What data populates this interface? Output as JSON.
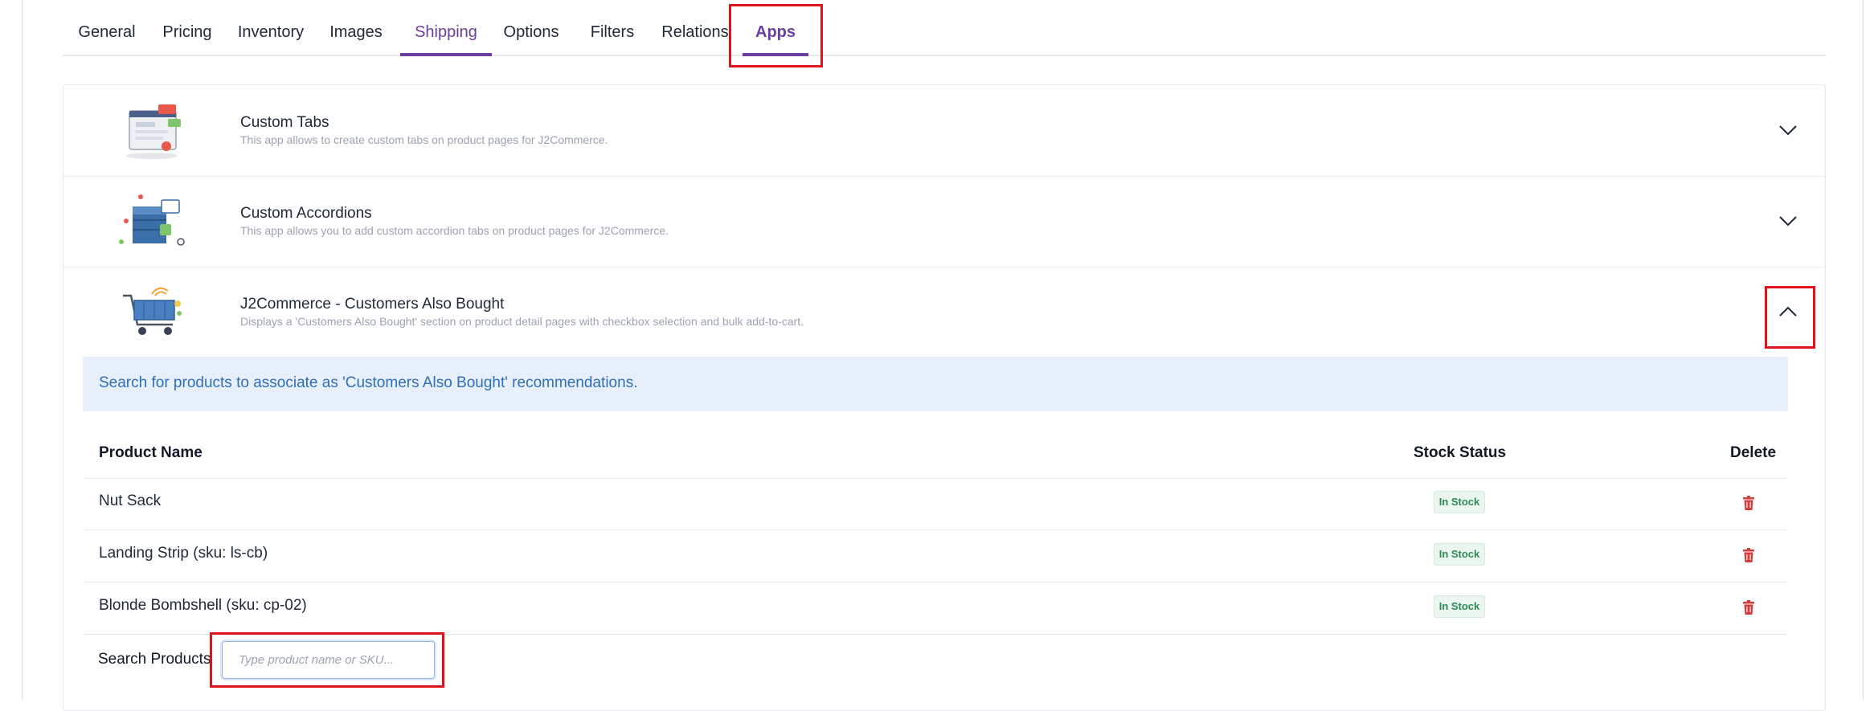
{
  "tabs": [
    {
      "label": "General"
    },
    {
      "label": "Pricing"
    },
    {
      "label": "Inventory"
    },
    {
      "label": "Images"
    },
    {
      "label": "Shipping"
    },
    {
      "label": "Options"
    },
    {
      "label": "Filters"
    },
    {
      "label": "Relations"
    },
    {
      "label": "Apps"
    }
  ],
  "apps": [
    {
      "title": "Custom Tabs",
      "description": "This app allows to create custom tabs on product pages for J2Commerce.",
      "state": "collapsed",
      "icon": "custom-tabs-illustration"
    },
    {
      "title": "Custom Accordions",
      "description": "This app allows you to add custom accordion tabs on product pages for J2Commerce.",
      "state": "collapsed",
      "icon": "custom-accordions-illustration"
    },
    {
      "title": "J2Commerce - Customers Also Bought",
      "description": "Displays a 'Customers Also Bought' section on product detail pages with checkbox selection and bulk add-to-cart.",
      "state": "expanded",
      "icon": "shopping-cart-illustration"
    }
  ],
  "info_message": "Search for products to associate as 'Customers Also Bought' recommendations.",
  "table": {
    "headers": {
      "name": "Product Name",
      "stock": "Stock Status",
      "delete": "Delete"
    },
    "rows": [
      {
        "name": "Nut Sack",
        "stock": "In Stock"
      },
      {
        "name": "Landing Strip (sku: ls-cb)",
        "stock": "In Stock"
      },
      {
        "name": "Blonde Bombshell (sku: cp-02)",
        "stock": "In Stock"
      }
    ]
  },
  "search": {
    "label": "Search Products",
    "placeholder": "Type product name or SKU...",
    "value": ""
  },
  "colors": {
    "accent": "#6b3fa0",
    "highlight": "#e0121b",
    "info_bg": "#e7effb",
    "info_text": "#2f6fb5",
    "stock_green": "#2e8b57",
    "delete_red": "#d63b3b"
  }
}
